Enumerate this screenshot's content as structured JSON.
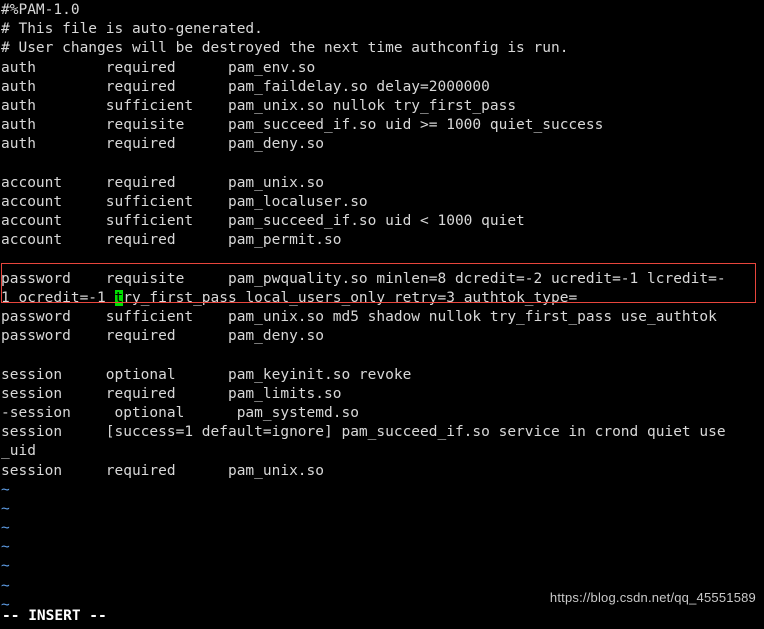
{
  "terminal": {
    "app": "vim",
    "colors": {
      "background": "#000000",
      "foreground": "#d8d8d8",
      "tilde": "#5f9ee6",
      "cursor_bg": "#00e000",
      "cursor_fg": "#000000",
      "highlight_box": "#e8453c",
      "status_fg": "#ffffff",
      "watermark_fg": "#c9c9c9"
    },
    "lines": [
      "#%PAM-1.0",
      "# This file is auto-generated.",
      "# User changes will be destroyed the next time authconfig is run.",
      "auth        required      pam_env.so",
      "auth        required      pam_faildelay.so delay=2000000",
      "auth        sufficient    pam_unix.so nullok try_first_pass",
      "auth        requisite     pam_succeed_if.so uid >= 1000 quiet_success",
      "auth        required      pam_deny.so",
      "",
      "account     required      pam_unix.so",
      "account     sufficient    pam_localuser.so",
      "account     sufficient    pam_succeed_if.so uid < 1000 quiet",
      "account     required      pam_permit.so",
      ""
    ],
    "highlighted_line_part1": "password    requisite     pam_pwquality.so minlen=8 dcredit=-2 ucredit=-1 lcredit=-",
    "highlighted_line_part2_before_cursor": "1 ocredit=-1 ",
    "highlighted_line_cursor_char": "t",
    "highlighted_line_part2_after_cursor": "ry_first_pass local_users_only retry=3 authtok_type=",
    "lines_after": [
      "password    sufficient    pam_unix.so md5 shadow nullok try_first_pass use_authtok",
      "password    required      pam_deny.so",
      "",
      "session     optional      pam_keyinit.so revoke",
      "session     required      pam_limits.so",
      "-session     optional      pam_systemd.so",
      "session     [success=1 default=ignore] pam_succeed_if.so service in crond quiet use",
      "_uid",
      "session     required      pam_unix.so"
    ],
    "tilde_rows": [
      "~",
      "~",
      "~",
      "~",
      "~",
      "~",
      "~"
    ],
    "status_text": "-- INSERT --",
    "watermark_text": "https://blog.csdn.net/qq_45551589"
  }
}
